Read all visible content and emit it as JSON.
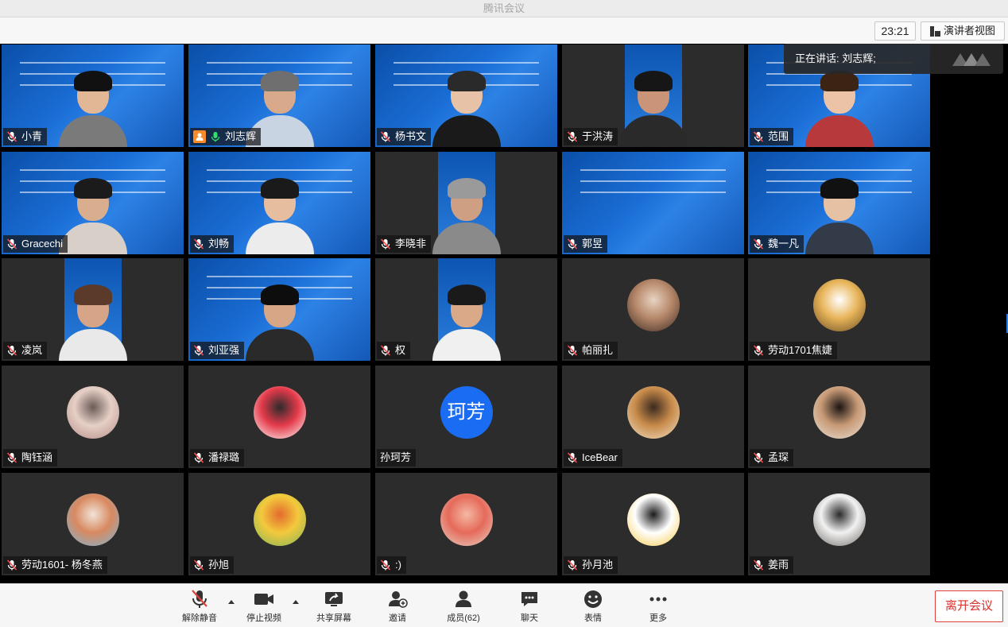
{
  "window": {
    "title": "腾讯会议"
  },
  "topbar": {
    "clock": "23:21",
    "view_button": "演讲者视图"
  },
  "speaking": {
    "label": "正在讲话: 刘志辉;"
  },
  "participants": [
    {
      "name": "小青",
      "kind": "full",
      "muted": true,
      "shirt": "#7a7a7a",
      "skin": "#e2b796",
      "hair": "#111111"
    },
    {
      "name": "刘志辉",
      "kind": "full",
      "muted": false,
      "host": true,
      "speaking": true,
      "shirt": "#c9d4e3",
      "skin": "#d8a98a",
      "hair": "#6f6f6f"
    },
    {
      "name": "杨书文",
      "kind": "full",
      "muted": true,
      "shirt": "#1a1a1a",
      "skin": "#e8c2a6",
      "hair": "#2a2a2a"
    },
    {
      "name": "于洪涛",
      "kind": "partial",
      "muted": true,
      "shirt": "#2a2a2a",
      "skin": "#c99478",
      "hair": "#161616"
    },
    {
      "name": "范围",
      "kind": "full",
      "muted": true,
      "shirt": "#b8393b",
      "skin": "#edc3a8",
      "hair": "#3b2414"
    },
    {
      "name": "Gracechi",
      "kind": "full",
      "muted": true,
      "shirt": "#d8cfc8",
      "skin": "#d9ae8f",
      "hair": "#1b1b1b"
    },
    {
      "name": "刘畅",
      "kind": "full",
      "muted": true,
      "shirt": "#ececec",
      "skin": "#e6be9f",
      "hair": "#1a1a1a"
    },
    {
      "name": "李晓非",
      "kind": "partial",
      "muted": true,
      "shirt": "#8a8a8a",
      "skin": "#cf9f83",
      "hair": "#9a9a9a"
    },
    {
      "name": "郭昱",
      "kind": "full",
      "muted": true,
      "empty": true
    },
    {
      "name": "魏一凡",
      "kind": "full",
      "muted": true,
      "shirt": "#333a48",
      "skin": "#e7c1a4",
      "hair": "#111111"
    },
    {
      "name": "凌岚",
      "kind": "partial",
      "muted": true,
      "shirt": "#e9e9e9",
      "skin": "#d6a486",
      "hair": "#5b3a2a"
    },
    {
      "name": "刘亚强",
      "kind": "full",
      "muted": true,
      "shirt": "#2a2a2a",
      "skin": "#d7a686",
      "hair": "#0d0d0d"
    },
    {
      "name": "权",
      "kind": "partial",
      "muted": true,
      "shirt": "#f0f0f0",
      "skin": "#d9a988",
      "hair": "#1a1a1a"
    },
    {
      "name": "帕丽扎",
      "kind": "avatar",
      "muted": true,
      "colors": [
        "#3b2a22",
        "#b6886a",
        "#e8d3c2"
      ]
    },
    {
      "name": "劳动1701焦婕",
      "kind": "avatar",
      "muted": true,
      "colors": [
        "#6a4b22",
        "#e8b55a",
        "#ffffff"
      ]
    },
    {
      "name": "陶钰涵",
      "kind": "avatar",
      "muted": true,
      "colors": [
        "#b48c86",
        "#e6d0c6",
        "#6b5a56"
      ]
    },
    {
      "name": "潘禄璐",
      "kind": "avatar",
      "muted": true,
      "colors": [
        "#ffffff",
        "#e43a4a",
        "#2b2b2b"
      ]
    },
    {
      "name": "孙珂芳",
      "kind": "text",
      "muted": false,
      "avatar_text": "珂芳"
    },
    {
      "name": "IceBear",
      "kind": "avatar",
      "muted": true,
      "colors": [
        "#f2e2c6",
        "#c78a4a",
        "#3a2a1f"
      ]
    },
    {
      "name": "孟琛",
      "kind": "avatar",
      "muted": true,
      "colors": [
        "#e9e2d8",
        "#c89a76",
        "#1a1412"
      ]
    },
    {
      "name": "劳动1601- 杨冬燕",
      "kind": "avatar",
      "muted": true,
      "colors": [
        "#7bb7d9",
        "#d88960",
        "#f0e4d8"
      ]
    },
    {
      "name": "孙旭",
      "kind": "avatar",
      "muted": true,
      "colors": [
        "#7fb55a",
        "#f3c93c",
        "#e36a2e"
      ]
    },
    {
      "name": ":)",
      "kind": "avatar",
      "muted": true,
      "colors": [
        "#e8d6c8",
        "#e56a5a",
        "#f4b8a3"
      ]
    },
    {
      "name": "孙月池",
      "kind": "avatar",
      "muted": true,
      "colors": [
        "#f7c948",
        "#ffffff",
        "#1a1a1a"
      ]
    },
    {
      "name": "姜雨",
      "kind": "avatar",
      "muted": true,
      "colors": [
        "#6e6a66",
        "#f2f2f2",
        "#2a2a2a"
      ]
    }
  ],
  "toolbar": {
    "unmute": "解除静音",
    "stop_video": "停止视频",
    "share": "共享屏幕",
    "invite": "邀请",
    "members": "成员(62)",
    "chat": "聊天",
    "emoji": "表情",
    "more": "更多",
    "leave": "离开会议"
  },
  "colors": {
    "speaking_border": "#1ed35b",
    "leave_red": "#d9302a",
    "avatar_blue": "#1a6cf2"
  }
}
